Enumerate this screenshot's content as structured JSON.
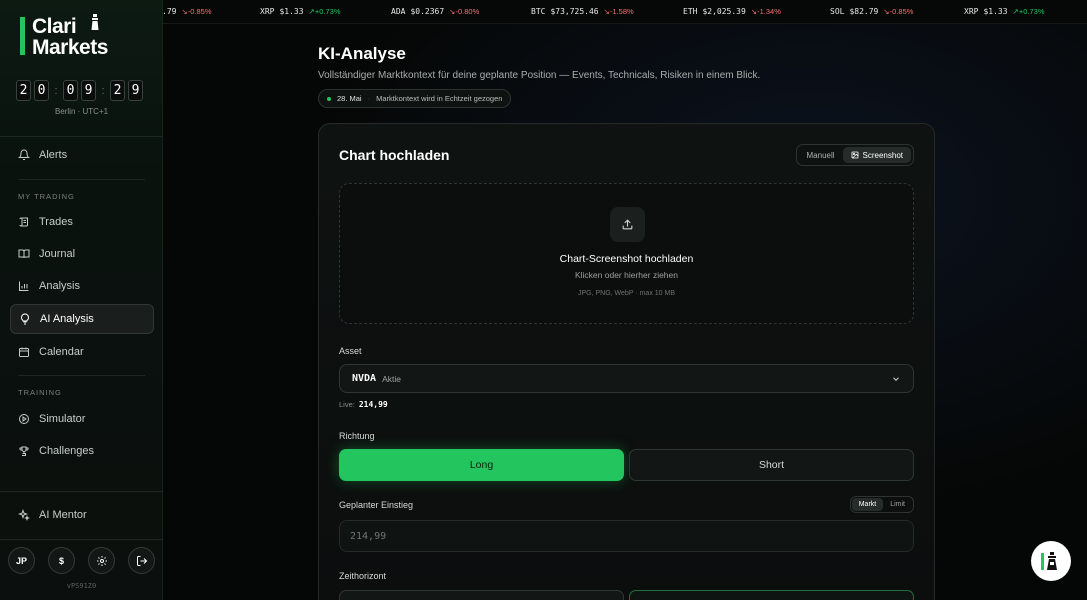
{
  "brand": {
    "line1": "Clari",
    "line2": "Markets",
    "accent": "#22c55e"
  },
  "clock": {
    "h1": "2",
    "h2": "0",
    "m1": "0",
    "m2": "9",
    "s1": "2",
    "s2": "9",
    "sep": ":",
    "tz": "Berlin · UTC+1"
  },
  "nav": {
    "alerts": "Alerts",
    "section_trading": "MY TRADING",
    "trades": "Trades",
    "journal": "Journal",
    "analysis": "Analysis",
    "ai_analysis": "AI Analysis",
    "calendar": "Calendar",
    "section_training": "TRAINING",
    "simulator": "Simulator",
    "challenges": "Challenges",
    "ai_mentor": "AI Mentor"
  },
  "user": {
    "initials": "JP",
    "currency": "$"
  },
  "version": "vPS91Z0",
  "ticker": [
    {
      "sym": "",
      "price": ".79",
      "chg": "-0.85%",
      "dir": "down"
    },
    {
      "sym": "XRP",
      "price": "$1.33",
      "chg": "+0.73%",
      "dir": "up"
    },
    {
      "sym": "ADA",
      "price": "$0.2367",
      "chg": "-0.80%",
      "dir": "down"
    },
    {
      "sym": "BTC",
      "price": "$73,725.46",
      "chg": "-1.58%",
      "dir": "down"
    },
    {
      "sym": "ETH",
      "price": "$2,025.39",
      "chg": "-1.34%",
      "dir": "down"
    },
    {
      "sym": "SOL",
      "price": "$82.79",
      "chg": "-0.85%",
      "dir": "down"
    },
    {
      "sym": "XRP",
      "price": "$1.33",
      "chg": "+0.73%",
      "dir": "up"
    }
  ],
  "page": {
    "title": "KI-Analyse",
    "subtitle": "Vollständiger Marktkontext für deine geplante Position — Events, Technicals, Risiken in einem Blick.",
    "pill_date": "28. Mai",
    "pill_sep": "·",
    "pill_text": "Marktkontext wird in Echtzeit gezogen"
  },
  "card": {
    "title": "Chart hochladen",
    "mode_manual": "Manuell",
    "mode_screenshot": "Screenshot",
    "upload_title": "Chart-Screenshot hochladen",
    "upload_hint": "Klicken oder hierher ziehen",
    "upload_formats": "JPG, PNG, WebP · max 10 MB",
    "asset_label": "Asset",
    "asset_ticker": "NVDA",
    "asset_type": "Aktie",
    "live_label": "Live:",
    "live_value": "214,99",
    "direction_label": "Richtung",
    "long": "Long",
    "short": "Short",
    "entry_label": "Geplanter Einstieg",
    "entry_market": "Markt",
    "entry_limit": "Limit",
    "entry_placeholder": "214,99",
    "horizon_label": "Zeithorizont"
  }
}
